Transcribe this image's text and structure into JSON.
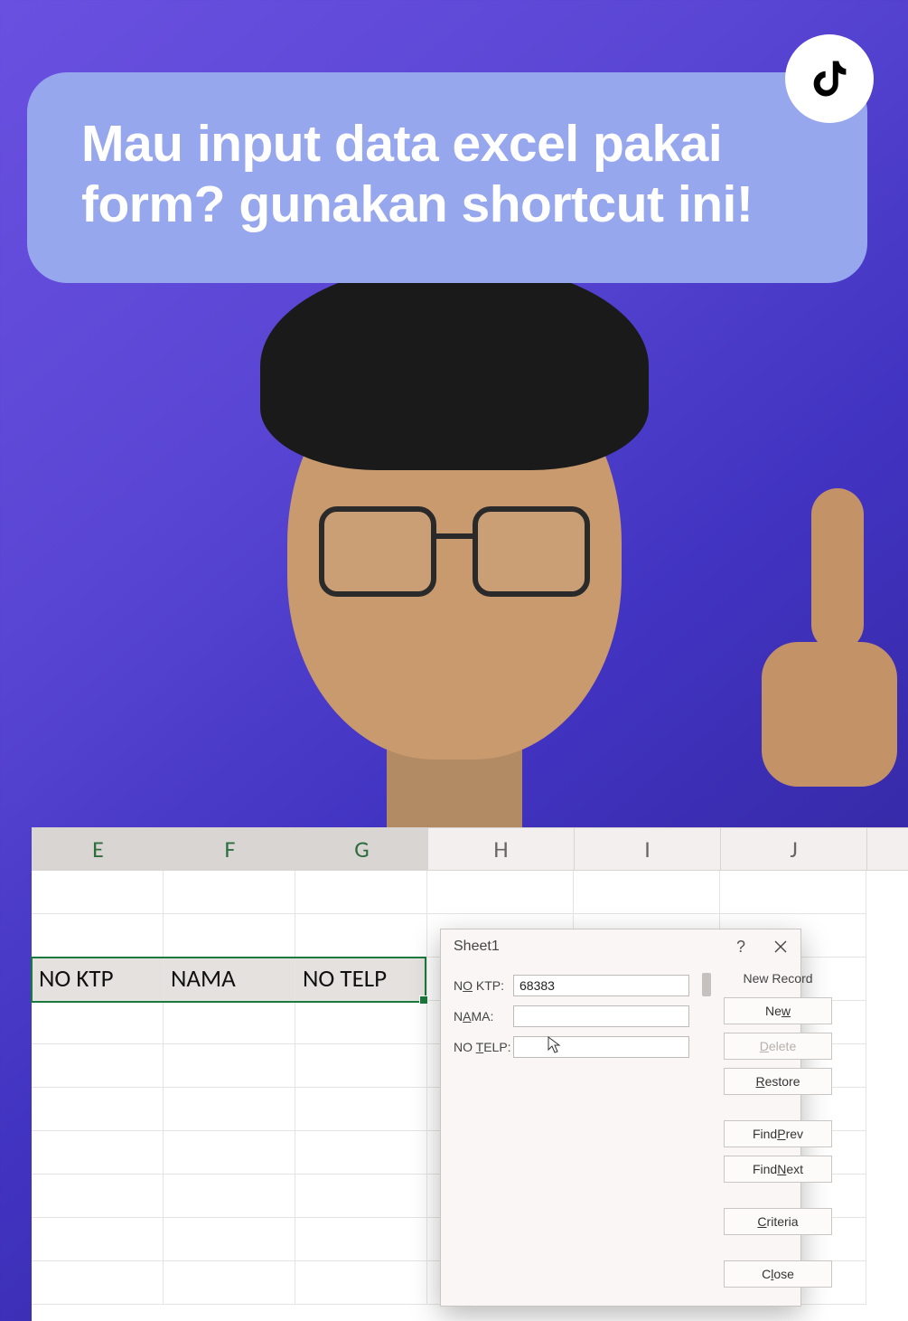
{
  "caption": "Mau input data excel pakai form? gunakan shortcut ini!",
  "badge_icon": "tiktok-icon",
  "spreadsheet": {
    "columns": [
      "E",
      "F",
      "G",
      "H",
      "I",
      "J"
    ],
    "selected_columns": [
      "E",
      "F",
      "G"
    ],
    "header_row": {
      "E": "NO KTP",
      "F": "NAMA",
      "G": "NO TELP"
    }
  },
  "dialog": {
    "title": "Sheet1",
    "help": "?",
    "status": "New Record",
    "fields": [
      {
        "label_pre": "N",
        "label_u": "O",
        "label_post": " KTP:",
        "value": "68383"
      },
      {
        "label_pre": "N",
        "label_u": "A",
        "label_post": "MA:",
        "value": ""
      },
      {
        "label_pre": "NO ",
        "label_u": "T",
        "label_post": "ELP:",
        "value": ""
      }
    ],
    "buttons": {
      "new": {
        "u": "w",
        "pre": "Ne",
        "post": ""
      },
      "delete": {
        "u": "D",
        "pre": "",
        "post": "elete",
        "disabled": true
      },
      "restore": {
        "u": "R",
        "pre": "",
        "post": "estore"
      },
      "findprev": {
        "u": "P",
        "pre": "Find ",
        "post": "rev"
      },
      "findnext": {
        "u": "N",
        "pre": "Find ",
        "post": "ext"
      },
      "criteria": {
        "u": "C",
        "pre": "",
        "post": "riteria"
      },
      "close": {
        "u": "l",
        "pre": "C",
        "post": "ose"
      }
    }
  }
}
